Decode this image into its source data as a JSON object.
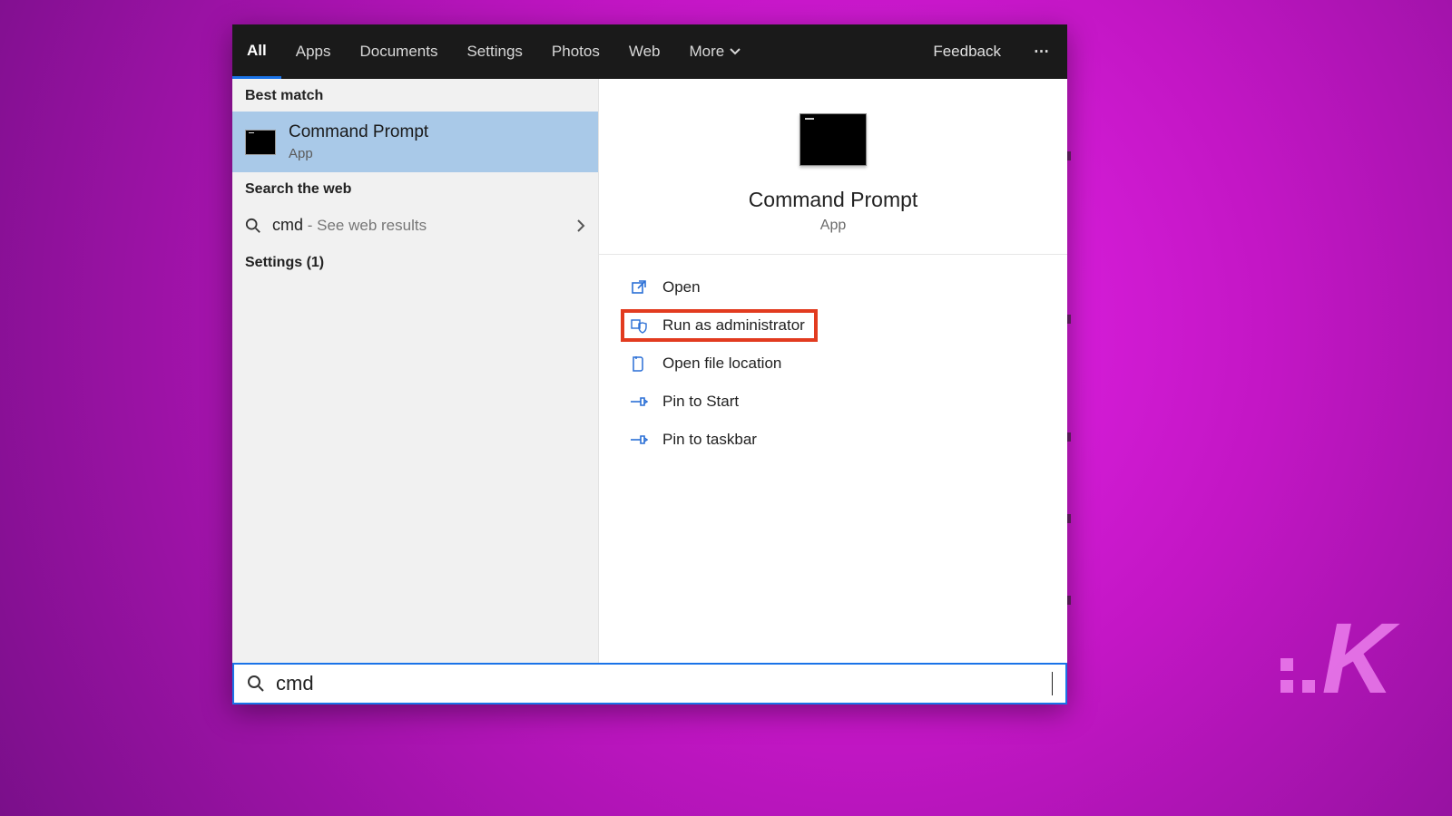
{
  "tabs": {
    "all": "All",
    "apps": "Apps",
    "documents": "Documents",
    "settings": "Settings",
    "photos": "Photos",
    "web": "Web",
    "more": "More"
  },
  "topbar": {
    "feedback": "Feedback",
    "more_menu": "⋯"
  },
  "left": {
    "best_match_label": "Best match",
    "best_match": {
      "title": "Command Prompt",
      "subtitle": "App"
    },
    "search_web_label": "Search the web",
    "web_result": {
      "term": "cmd",
      "suffix": " - See web results"
    },
    "settings_label": "Settings (1)"
  },
  "right": {
    "title": "Command Prompt",
    "subtitle": "App",
    "actions": {
      "open": "Open",
      "run_admin": "Run as administrator",
      "open_loc": "Open file location",
      "pin_start": "Pin to Start",
      "pin_taskbar": "Pin to taskbar"
    }
  },
  "search": {
    "value": "cmd"
  },
  "logo": {
    "letter": "K"
  }
}
